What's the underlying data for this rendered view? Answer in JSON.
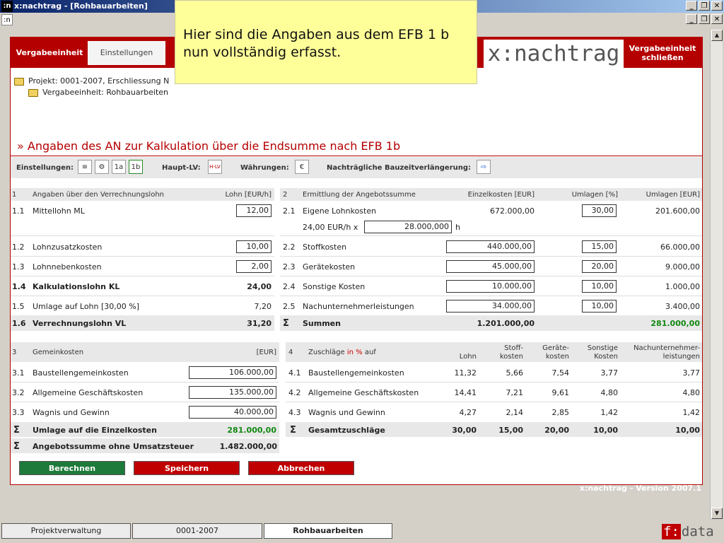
{
  "window": {
    "title": "x:nachtrag - [Rohbauarbeiten]",
    "logo": ":n",
    "controls": [
      "_",
      "❒",
      "✕"
    ]
  },
  "subwindow": {
    "logo": ":n"
  },
  "tabs": {
    "active": "Vergabeeinheit",
    "inactive": "Einstellungen"
  },
  "brand": "x:nachtrag",
  "close_button": {
    "line1": "Vergabeeinheit",
    "line2": "schließen"
  },
  "tree": {
    "project": "Projekt: 0001-2007, Erschliessung N",
    "unit": "Vergabeeinheit: Rohbauarbeiten"
  },
  "heading": "» Angaben des AN zur Kalkulation über die Endsumme nach EFB 1b",
  "toolbar": {
    "settings_label": "Einstellungen:",
    "settings_icons": [
      "≡",
      "⚙",
      "1a",
      "1b"
    ],
    "haupt_label": "Haupt-LV:",
    "haupt_icon": "H-LV",
    "currency_label": "Währungen:",
    "currency_icon": "€",
    "extension_label": "Nachträgliche Bauzeitverlängerung:",
    "extension_icon": "⇨"
  },
  "section1": {
    "num": "1",
    "title": "Angaben über den Verrechnungslohn",
    "col": "Lohn [EUR/h]",
    "rows": [
      {
        "num": "1.1",
        "label": "Mittellohn ML",
        "value": "12,00"
      },
      {
        "num": "1.2",
        "label": "Lohnzusatzkosten",
        "value": "10,00"
      },
      {
        "num": "1.3",
        "label": "Lohnnebenkosten",
        "value": "2,00"
      },
      {
        "num": "1.4",
        "label": "Kalkulationslohn KL",
        "value": "24,00"
      },
      {
        "num": "1.5",
        "label": "Umlage auf Lohn [30,00 %]",
        "value": "7,20"
      },
      {
        "num": "1.6",
        "label": "Verrechnungslohn VL",
        "value": "31,20"
      }
    ]
  },
  "section2": {
    "num": "2",
    "title": "Ermittlung der Angebotssumme",
    "cols": [
      "Einzelkosten [EUR]",
      "Umlagen [%]",
      "Umlagen [EUR]"
    ],
    "rows": [
      {
        "num": "2.1",
        "label": "Eigene Lohnkosten",
        "einzel": "672.000,00",
        "pct": "30,00",
        "eur": "201.600,00"
      },
      {
        "num": "2.2",
        "label": "Stoffkosten",
        "einzel": "440.000,00",
        "pct": "15,00",
        "eur": "66.000,00"
      },
      {
        "num": "2.3",
        "label": "Gerätekosten",
        "einzel": "45.000,00",
        "pct": "20,00",
        "eur": "9.000,00"
      },
      {
        "num": "2.4",
        "label": "Sonstige Kosten",
        "einzel": "10.000,00",
        "pct": "10,00",
        "eur": "1.000,00"
      },
      {
        "num": "2.5",
        "label": "Nachunternehmerleistungen",
        "einzel": "34.000,00",
        "pct": "10,00",
        "eur": "3.400,00"
      }
    ],
    "hours": {
      "rate": "24,00 EUR/h x",
      "value": "28.000,000",
      "unit": "h"
    },
    "sum": {
      "symbol": "Σ",
      "label": "Summen",
      "einzel": "1.201.000,00",
      "eur": "281.000,00"
    }
  },
  "section3": {
    "num": "3",
    "title": "Gemeinkosten",
    "col": "[EUR]",
    "rows": [
      {
        "num": "3.1",
        "label": "Baustellengemeinkosten",
        "value": "106.000,00"
      },
      {
        "num": "3.2",
        "label": "Allgemeine Geschäftskosten",
        "value": "135.000,00"
      },
      {
        "num": "3.3",
        "label": "Wagnis und Gewinn",
        "value": "40.000,00"
      }
    ],
    "sum1": {
      "symbol": "Σ",
      "label": "Umlage auf die Einzelkosten",
      "value": "281.000,00"
    },
    "sum2": {
      "symbol": "Σ",
      "label": "Angebotssumme ohne Umsatzsteuer",
      "value": "1.482.000,00"
    }
  },
  "section4": {
    "num": "4",
    "title_pre": "Zuschläge",
    "title_red": "in %",
    "title_post": "auf",
    "cols": [
      {
        "l1": "",
        "l2": "Lohn"
      },
      {
        "l1": "Stoff-",
        "l2": "kosten"
      },
      {
        "l1": "Geräte-",
        "l2": "kosten"
      },
      {
        "l1": "Sonstige",
        "l2": "Kosten"
      },
      {
        "l1": "Nachunternehmer-",
        "l2": "leistungen"
      }
    ],
    "rows": [
      {
        "num": "4.1",
        "label": "Baustellengemeinkosten",
        "v": [
          "11,32",
          "5,66",
          "7,54",
          "3,77",
          "3,77"
        ]
      },
      {
        "num": "4.2",
        "label": "Allgemeine Geschäftskosten",
        "v": [
          "14,41",
          "7,21",
          "9,61",
          "4,80",
          "4,80"
        ]
      },
      {
        "num": "4.3",
        "label": "Wagnis und Gewinn",
        "v": [
          "4,27",
          "2,14",
          "2,85",
          "1,42",
          "1,42"
        ]
      }
    ],
    "sum": {
      "symbol": "Σ",
      "label": "Gesamtzuschläge",
      "v": [
        "30,00",
        "15,00",
        "20,00",
        "10,00",
        "10,00"
      ]
    }
  },
  "buttons": {
    "calc": "Berechnen",
    "save": "Speichern",
    "cancel": "Abbrechen"
  },
  "version": "x:nachtrag - Version 2007.1",
  "taskbar": [
    "Projektverwaltung",
    "0001-2007",
    "Rohbauarbeiten"
  ],
  "fdata": {
    "f": "f:",
    "rest": "data"
  },
  "note": "Hier sind die Angaben aus dem EFB 1 b nun vollständig erfasst.",
  "colors": {
    "brand_red": "#b40000",
    "green": "#118811",
    "save_red": "#c00000",
    "calc_green": "#1e7a3a",
    "note_yellow": "#ffff99"
  }
}
